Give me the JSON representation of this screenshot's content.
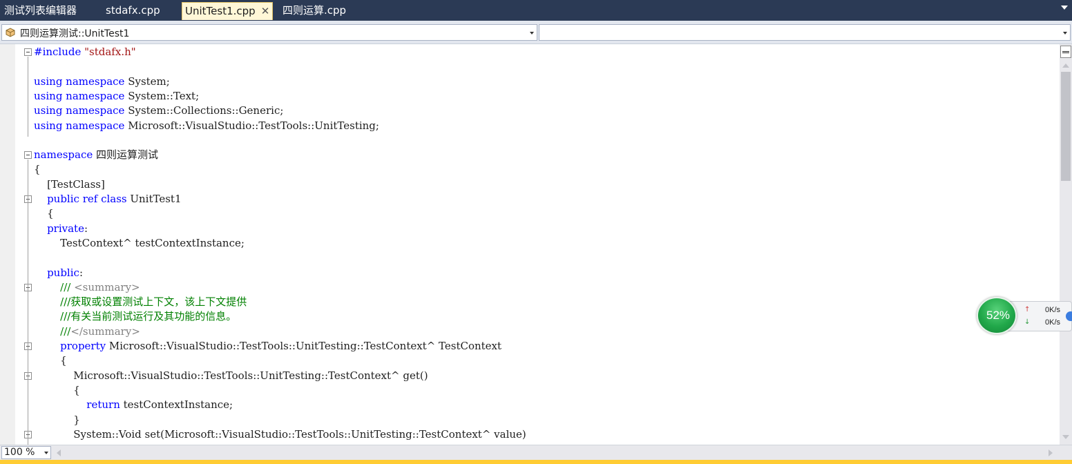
{
  "tabs": [
    {
      "label": "测试列表编辑器",
      "active": false
    },
    {
      "label": "stdafx.cpp",
      "active": false
    },
    {
      "label": "UnitTest1.cpp",
      "active": true
    },
    {
      "label": "四则运算.cpp",
      "active": false
    }
  ],
  "tab_close_glyph": "✕",
  "navbar": {
    "scope": "四则运算测试::UnitTest1",
    "member": ""
  },
  "code_lines": [
    [
      {
        "t": "#include ",
        "c": "kw"
      },
      {
        "t": "\"stdafx.h\"",
        "c": "str"
      }
    ],
    [],
    [
      {
        "t": "using namespace",
        "c": "kw"
      },
      {
        "t": " System;",
        "c": ""
      }
    ],
    [
      {
        "t": "using namespace",
        "c": "kw"
      },
      {
        "t": " System::Text;",
        "c": ""
      }
    ],
    [
      {
        "t": "using namespace",
        "c": "kw"
      },
      {
        "t": " System::Collections::Generic;",
        "c": ""
      }
    ],
    [
      {
        "t": "using namespace",
        "c": "kw"
      },
      {
        "t": " Microsoft::VisualStudio::TestTools::UnitTesting;",
        "c": ""
      }
    ],
    [],
    [
      {
        "t": "namespace",
        "c": "kw"
      },
      {
        "t": " 四则运算测试",
        "c": "cjk"
      }
    ],
    [
      {
        "t": "{",
        "c": ""
      }
    ],
    [
      {
        "t": "    [TestClass]",
        "c": ""
      }
    ],
    [
      {
        "t": "    public ref class",
        "c": "kw"
      },
      {
        "t": " UnitTest1",
        "c": ""
      }
    ],
    [
      {
        "t": "    {",
        "c": ""
      }
    ],
    [
      {
        "t": "    private",
        "c": "kw"
      },
      {
        "t": ":",
        "c": ""
      }
    ],
    [
      {
        "t": "        TestContext^ testContextInstance;",
        "c": ""
      }
    ],
    [],
    [
      {
        "t": "    public",
        "c": "kw"
      },
      {
        "t": ":",
        "c": ""
      }
    ],
    [
      {
        "t": "        /// ",
        "c": "cm"
      },
      {
        "t": "<summary>",
        "c": "cmg"
      }
    ],
    [
      {
        "t": "        ///获取或设置测试上下文，该上下文提供",
        "c": "cm cjk"
      }
    ],
    [
      {
        "t": "        ///有关当前测试运行及其功能的信息。",
        "c": "cm cjk"
      }
    ],
    [
      {
        "t": "        ///",
        "c": "cm"
      },
      {
        "t": "</summary>",
        "c": "cmg"
      }
    ],
    [
      {
        "t": "        property",
        "c": "kw"
      },
      {
        "t": " Microsoft::VisualStudio::TestTools::UnitTesting::TestContext^ TestContext",
        "c": ""
      }
    ],
    [
      {
        "t": "        {",
        "c": ""
      }
    ],
    [
      {
        "t": "            Microsoft::VisualStudio::TestTools::UnitTesting::TestContext^ get()",
        "c": ""
      }
    ],
    [
      {
        "t": "            {",
        "c": ""
      }
    ],
    [
      {
        "t": "                return",
        "c": "kw"
      },
      {
        "t": " testContextInstance;",
        "c": ""
      }
    ],
    [
      {
        "t": "            }",
        "c": ""
      }
    ],
    [
      {
        "t": "            System::Void set(Microsoft::VisualStudio::TestTools::UnitTesting::TestContext^ value)",
        "c": ""
      }
    ],
    [
      {
        "t": "            {",
        "c": ""
      }
    ]
  ],
  "zoom": "100 %",
  "net_widget": {
    "percent": "52%",
    "cpu_fraction": 0.52,
    "upload": "0K/s",
    "download": "0K/s",
    "up_glyph": "↑",
    "down_glyph": "↓"
  }
}
